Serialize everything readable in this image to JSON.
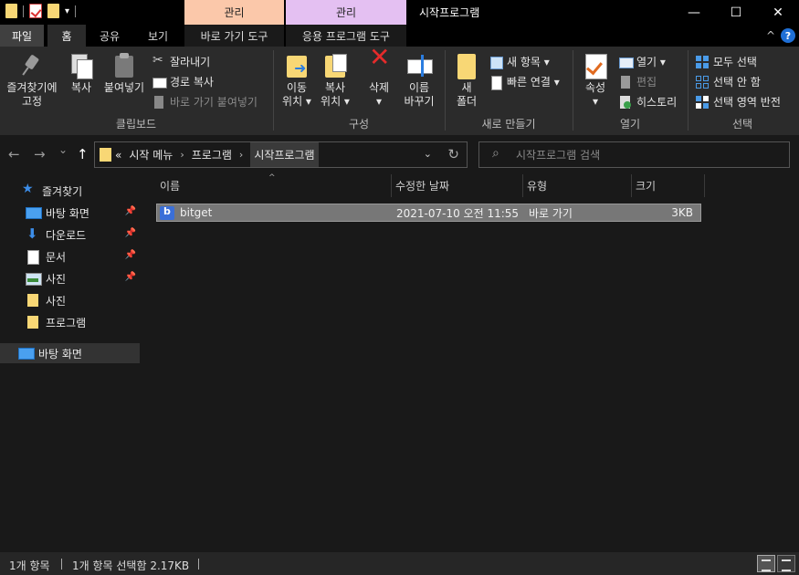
{
  "titlebar": {
    "window_title": "시작프로그램",
    "context_tab_manage_1": "관리",
    "context_tab_manage_2": "관리",
    "minimize": "—",
    "maximize": "☐",
    "close": "✕",
    "context_colors": {
      "shortcut_tools": "#fbc8aa",
      "app_tools": "#e4c0f2"
    }
  },
  "ribbon_tabs": {
    "file": "파일",
    "home": "홈",
    "share": "공유",
    "view": "보기",
    "shortcut_tools": "바로 가기 도구",
    "app_tools": "응용 프로그램 도구",
    "collapse": "^",
    "help": "?"
  },
  "ribbon": {
    "clipboard": {
      "label": "클립보드",
      "pin_to_quick_access": [
        "즐겨찾기에",
        "고정"
      ],
      "copy": "복사",
      "paste": "붙여넣기",
      "cut": "잘라내기",
      "copy_path": "경로 복사",
      "paste_shortcut": "바로 가기 붙여넣기"
    },
    "organize": {
      "label": "구성",
      "move_to": [
        "이동",
        "위치 ▾"
      ],
      "copy_to": [
        "복사",
        "위치 ▾"
      ],
      "delete": [
        "삭제",
        "▾"
      ],
      "rename": [
        "이름",
        "바꾸기"
      ]
    },
    "new": {
      "label": "새로 만들기",
      "new_folder": [
        "새",
        "폴더"
      ],
      "new_item": "새 항목 ▾",
      "easy_access": "빠른 연결 ▾"
    },
    "open": {
      "label": "열기",
      "properties": [
        "속성",
        "▾"
      ],
      "open": "열기 ▾",
      "edit": "편집",
      "history": "히스토리"
    },
    "select": {
      "label": "선택",
      "select_all": "모두 선택",
      "select_none": "선택 안 함",
      "invert_selection": "선택 영역 반전"
    }
  },
  "address": {
    "back": "←",
    "forward": "→",
    "recent": "⌄",
    "up": "↑",
    "overflow": "«",
    "crumbs": [
      "시작 메뉴",
      "프로그램",
      "시작프로그램"
    ],
    "dropdown": "⌄",
    "refresh": "↻",
    "search_placeholder": "시작프로그램 검색"
  },
  "nav_pane": {
    "items": [
      {
        "label": "즐겨찾기",
        "icon": "star-icon"
      },
      {
        "label": "바탕 화면",
        "icon": "desktop-icon",
        "pinned": true
      },
      {
        "label": "다운로드",
        "icon": "download-icon",
        "pinned": true
      },
      {
        "label": "문서",
        "icon": "document-icon",
        "pinned": true
      },
      {
        "label": "사진",
        "icon": "pictures-icon",
        "pinned": true
      },
      {
        "label": "사진",
        "icon": "folder-icon"
      },
      {
        "label": "프로그램",
        "icon": "folder-icon"
      },
      {
        "label": "바탕 화면",
        "icon": "desktop-icon"
      }
    ],
    "pin_glyph": "📌"
  },
  "file_list": {
    "sort_indicator": "^",
    "columns": [
      "이름",
      "수정한 날짜",
      "유형",
      "크기"
    ],
    "rows": [
      {
        "name": "bitget",
        "modified": "2021-07-10 오전 11:55",
        "type": "바로 가기",
        "size": "3KB",
        "icon": "bitget-shortcut-icon",
        "selected": true
      }
    ]
  },
  "status": {
    "item_count": "1개 항목",
    "selection": "1개 항목 선택함 2.17KB"
  }
}
